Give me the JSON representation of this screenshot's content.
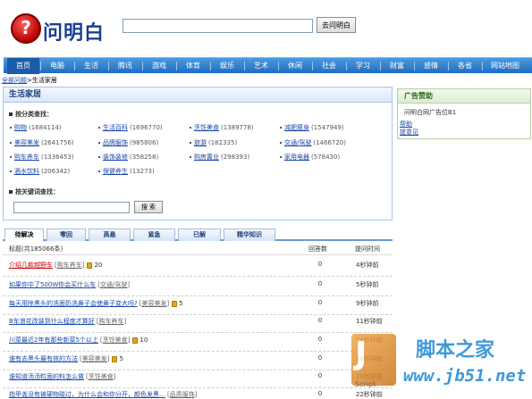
{
  "header": {
    "logo_text": "问明白",
    "logo_symbol": "?",
    "search_value": "",
    "search_button": "去问明白"
  },
  "nav": {
    "items": [
      "首页",
      "电脑",
      "生活",
      "腾讯",
      "游戏",
      "体育",
      "娱乐",
      "艺术",
      "休闲",
      "社会",
      "学习",
      "财富",
      "感情",
      "各省",
      "网站地图"
    ],
    "active_index": 0
  },
  "breadcrumb": {
    "home": "全部问题",
    "current": ">生活家居"
  },
  "main_box": {
    "title": "生活家居",
    "by_category_label": "按分类查找：",
    "categories": [
      {
        "name": "购物",
        "count": "(1684114)"
      },
      {
        "name": "生活百科",
        "count": "(1696770)"
      },
      {
        "name": "烹饪美食",
        "count": "(1389778)"
      },
      {
        "name": "减肥瘦身",
        "count": "(1547949)"
      },
      {
        "name": "美容美发",
        "count": "(2641756)"
      },
      {
        "name": "品牌服饰",
        "count": "(985806)"
      },
      {
        "name": "旅游",
        "count": "(182335)"
      },
      {
        "name": "交通/驾驶",
        "count": "(1466720)"
      },
      {
        "name": "购车养车",
        "count": "(1336453)"
      },
      {
        "name": "装饰装修",
        "count": "(358258)"
      },
      {
        "name": "购房置业",
        "count": "(298393)"
      },
      {
        "name": "家用电器",
        "count": "(578430)"
      },
      {
        "name": "酒水饮料",
        "count": "(206342)"
      },
      {
        "name": "保健养生",
        "count": "(13273)"
      }
    ],
    "by_keyword_label": "按关键词查找：",
    "keyword_value": "",
    "keyword_button": "搜 索"
  },
  "ad_box": {
    "title": "广告赞助",
    "text": "问明白网广告位B1",
    "link1": "帮助",
    "link2": "提意见"
  },
  "tabs": [
    "待解决",
    "零回",
    "高悬",
    "紧急",
    "已解",
    "精华知识"
  ],
  "active_tab": 0,
  "table": {
    "title_header": "标题(共185066条)",
    "answers_header": "回答数",
    "time_header": "提问时间",
    "rows": [
      {
        "title": "介绍几款越野车",
        "category": "购车养车",
        "reward": "20",
        "answers": "0",
        "time": "4秒钟前",
        "hot": true
      },
      {
        "title": "如果你中了500W你会买什么车",
        "category": "交通/驾驶",
        "reward": "",
        "answers": "0",
        "time": "5秒钟前",
        "hot": false
      },
      {
        "title": "每天用除黑头的洗面奶洗鼻子会使鼻子变大吗?",
        "category": "美容美发",
        "reward": "5",
        "answers": "0",
        "time": "9秒钟前",
        "hot": false
      },
      {
        "title": "B车浪花改装到什么程度才算好",
        "category": "购车养车",
        "reward": "",
        "answers": "0",
        "time": "11秒钟前",
        "hot": false
      },
      {
        "title": "川菜最近2年有那些新菜5个以上",
        "category": "烹饪美食",
        "reward": "10",
        "answers": "0",
        "time": "14秒钟前",
        "hot": false
      },
      {
        "title": "谁有去黑头最有效的方法",
        "category": "美容美发",
        "reward": "5",
        "answers": "0",
        "time": "16秒钟前",
        "hot": false
      },
      {
        "title": "谁知道汤汤粒面的料怎么做",
        "category": "烹饪美食",
        "reward": "",
        "answers": "0",
        "time": "20秒钟前",
        "hot": false
      },
      {
        "title": "指甲盖没有被硬物碰过，为什么会和你分开，颜色发黑…",
        "category": "品质服饰",
        "reward": "",
        "answers": "0",
        "time": "22秒钟前",
        "hot": false
      }
    ]
  },
  "watermark": {
    "badge": "J",
    "script_text": "Script",
    "title": "脚本之家",
    "url": "www.jb51.net"
  },
  "colors": {
    "nav_bg": "#1f6cc1",
    "link": "#1a48a8",
    "hot_link": "#cc0000",
    "logo_red": "#b80000",
    "logo_blue": "#1c3f94"
  }
}
